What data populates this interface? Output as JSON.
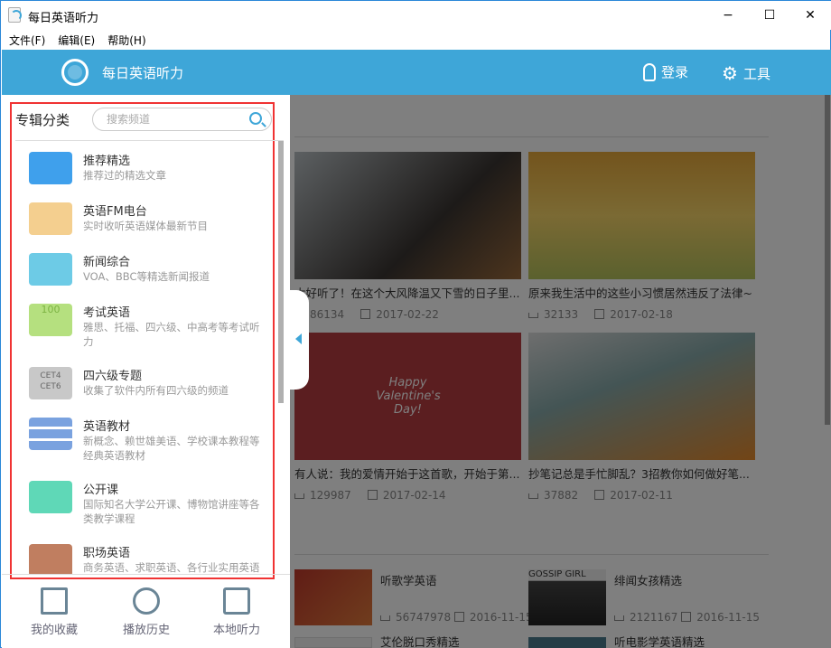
{
  "window": {
    "title": "每日英语听力",
    "minimize": "−",
    "maximize": "☐",
    "close": "✕"
  },
  "menu": [
    "文件(F)",
    "编辑(E)",
    "帮助(H)"
  ],
  "header": {
    "title": "每日英语听力",
    "login": "登录",
    "tools": "工具"
  },
  "sidebar": {
    "label": "专辑分类",
    "search_placeholder": "搜索频道",
    "items": [
      {
        "name": "推荐精选",
        "desc": "推荐过的精选文章",
        "color": "#3fa0ec"
      },
      {
        "name": "英语FM电台",
        "desc": "实时收听英语媒体最新节目",
        "color": "#f4cf8f"
      },
      {
        "name": "新闻综合",
        "desc": "VOA、BBC等精选新闻报道",
        "color": "#6dcbe6"
      },
      {
        "name": "考试英语",
        "desc": "雅思、托福、四六级、中高考等考试听力",
        "color": "#b5e07f",
        "badge": "100"
      },
      {
        "name": "四六级专题",
        "desc": "收集了软件内所有四六级的频道",
        "color": "#c8c8c8",
        "badge": "CET4 CET6"
      },
      {
        "name": "英语教材",
        "desc": "新概念、赖世雄美语、学校课本教程等经典英语教材",
        "color": "#7aa2df"
      },
      {
        "name": "公开课",
        "desc": "国际知名大学公开课、博物馆讲座等各类教学课程",
        "color": "#5fd8b7"
      },
      {
        "name": "职场英语",
        "desc": "商务英语、求职英语、各行业实用英语等听力",
        "color": "#c07e60"
      }
    ],
    "bottom": [
      "我的收藏",
      "播放历史",
      "本地听力"
    ]
  },
  "main": {
    "cards": [
      {
        "title": "太好听了！在这个大风降温又下雪的日子里...",
        "downloads": "86134",
        "date": "2017-02-22"
      },
      {
        "title": "原来我生活中的这些小习惯居然违反了法律~",
        "downloads": "32133",
        "date": "2017-02-18"
      },
      {
        "title": "有人说：我的爱情开始于这首歌，开始于第...",
        "downloads": "129987",
        "date": "2017-02-14",
        "img_text": "Happy Valentine's Day!"
      },
      {
        "title": "抄笔记总是手忙脚乱？3招教你如何做好笔...",
        "downloads": "37882",
        "date": "2017-02-11"
      }
    ],
    "albums": [
      {
        "title": "听歌学英语",
        "downloads": "56747978",
        "date": "2016-11-15"
      },
      {
        "title": "绯闻女孩精选",
        "downloads": "2121167",
        "date": "2016-11-15",
        "img_text": "GOSSIP GIRL"
      },
      {
        "title": "艾伦脱口秀精选"
      },
      {
        "title": "听电影学英语精选"
      }
    ]
  }
}
